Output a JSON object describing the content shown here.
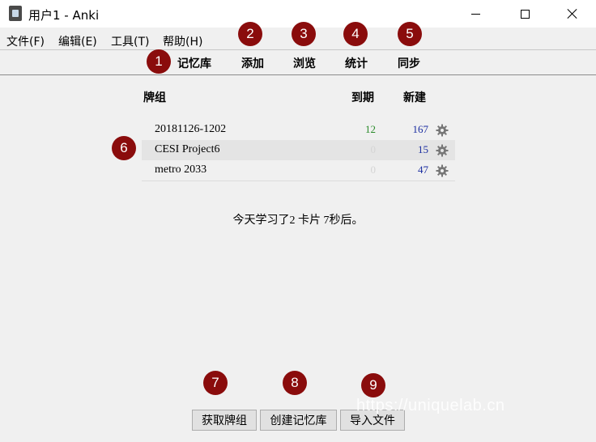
{
  "window": {
    "title": "用户1 - Anki"
  },
  "menu": {
    "file": "文件(F)",
    "edit": "编辑(E)",
    "tools": "工具(T)",
    "help": "帮助(H)"
  },
  "toolbar": {
    "decks": "记忆库",
    "add": "添加",
    "browse": "浏览",
    "stats": "统计",
    "sync": "同步"
  },
  "badges": [
    "1",
    "2",
    "3",
    "4",
    "5",
    "6",
    "7",
    "8",
    "9"
  ],
  "deck_table": {
    "headers": {
      "deck": "牌组",
      "due": "到期",
      "new": "新建"
    },
    "rows": [
      {
        "name": "20181126-1202",
        "due": "12",
        "new": "167"
      },
      {
        "name": "CESI Project6",
        "due": "0",
        "new": "15"
      },
      {
        "name": "metro 2033",
        "due": "0",
        "new": "47"
      }
    ]
  },
  "studied_today": "今天学习了2 卡片 7秒后。",
  "buttons": {
    "shared": "获取牌组",
    "create": "创建记忆库",
    "import": "导入文件"
  },
  "watermark": "https://uniquelab.cn",
  "colors": {
    "badge": "#8a0c0c",
    "due_count": "#2a8a2a",
    "new_count": "#1a2da0",
    "zero_count": "#d4d4d4"
  }
}
